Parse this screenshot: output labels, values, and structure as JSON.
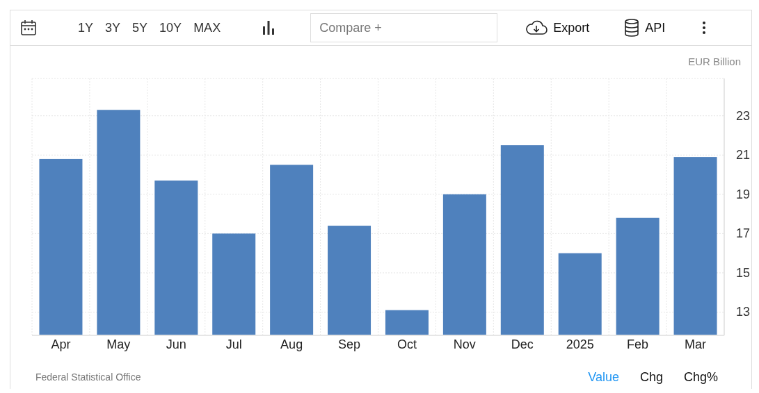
{
  "toolbar": {
    "ranges": [
      "1Y",
      "3Y",
      "5Y",
      "10Y",
      "MAX"
    ],
    "compare": {
      "placeholder": "Compare +"
    },
    "export": "Export",
    "api": "API"
  },
  "chart_data": {
    "type": "bar",
    "ylabel": "EUR Billion",
    "categories": [
      "Apr",
      "May",
      "Jun",
      "Jul",
      "Aug",
      "Sep",
      "Oct",
      "Nov",
      "Dec",
      "2025",
      "Feb",
      "Mar"
    ],
    "grid": true,
    "series": [
      {
        "color": "#4f81bd",
        "values": [
          20.8,
          23.3,
          19.7,
          17.0,
          20.5,
          17.4,
          13.1,
          19.0,
          21.5,
          16.0,
          17.8,
          20.9
        ]
      }
    ],
    "ylim": [
      11.85,
      24.9
    ],
    "yticks": [
      13,
      15,
      17,
      19,
      21,
      23
    ]
  },
  "footer": {
    "source": "Federal Statistical Office",
    "tabs": [
      {
        "label": "Value",
        "selected": true
      },
      {
        "label": "Chg",
        "selected": false
      },
      {
        "label": "Chg%",
        "selected": false
      }
    ]
  }
}
